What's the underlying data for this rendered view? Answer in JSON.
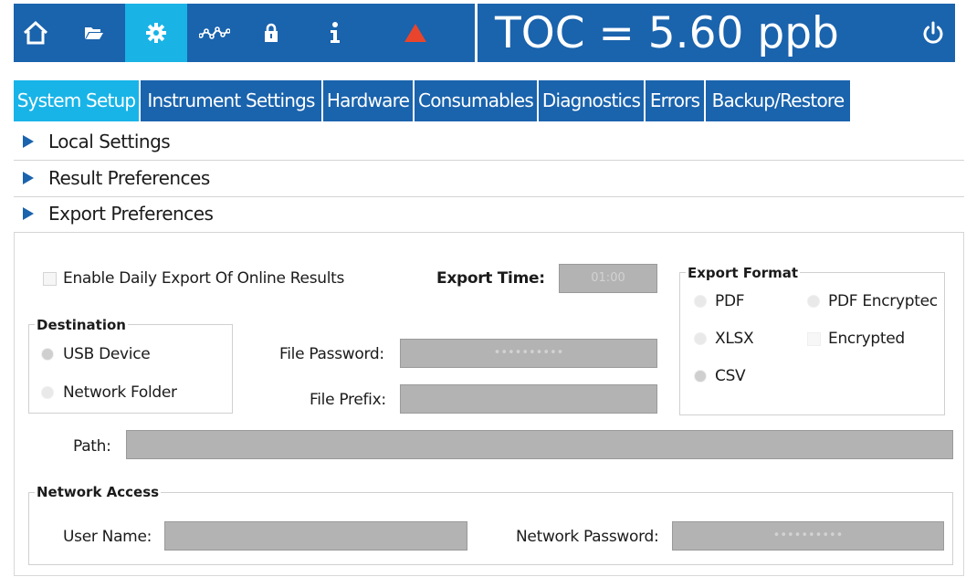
{
  "toolbar": {
    "icons": [
      "home-icon",
      "folder-icon",
      "gear-icon",
      "trend-icon",
      "lock-icon",
      "info-icon",
      "warning-icon",
      "power-icon"
    ],
    "active": "gear-icon",
    "measurement": "TOC = 5.60 ppb"
  },
  "tabs": [
    {
      "label": "System Setup",
      "active": true
    },
    {
      "label": "Instrument Settings"
    },
    {
      "label": "Hardware"
    },
    {
      "label": "Consumables"
    },
    {
      "label": "Diagnostics"
    },
    {
      "label": "Errors"
    },
    {
      "label": "Backup/Restore"
    }
  ],
  "sections": [
    {
      "label": "Local Settings"
    },
    {
      "label": "Result Preferences"
    },
    {
      "label": "Export Preferences",
      "expanded": true
    }
  ],
  "export": {
    "enable_daily_label": "Enable Daily Export Of Online Results",
    "enable_daily_checked": false,
    "export_time_label": "Export Time:",
    "export_time_value": "01:00",
    "destination": {
      "legend": "Destination",
      "options": [
        "USB Device",
        "Network Folder"
      ],
      "selected": "USB Device"
    },
    "file_password_label": "File Password:",
    "file_password_value": "••••••••••",
    "file_prefix_label": "File Prefix:",
    "file_prefix_value": "",
    "format": {
      "legend": "Export Format",
      "options": [
        "PDF",
        "PDF Encryptec",
        "XLSX",
        "Encrypted",
        "CSV"
      ],
      "selected": "CSV"
    },
    "path_label": "Path:",
    "path_value": "",
    "network": {
      "legend": "Network Access",
      "user_label": "User Name:",
      "user_value": "",
      "password_label": "Network Password:",
      "password_value": "••••••••••"
    }
  },
  "colors": {
    "brand_blue": "#1a63ad",
    "active_cyan": "#19b3e6",
    "field_gray": "#b3b3b3",
    "warning_red": "#e8452c"
  }
}
